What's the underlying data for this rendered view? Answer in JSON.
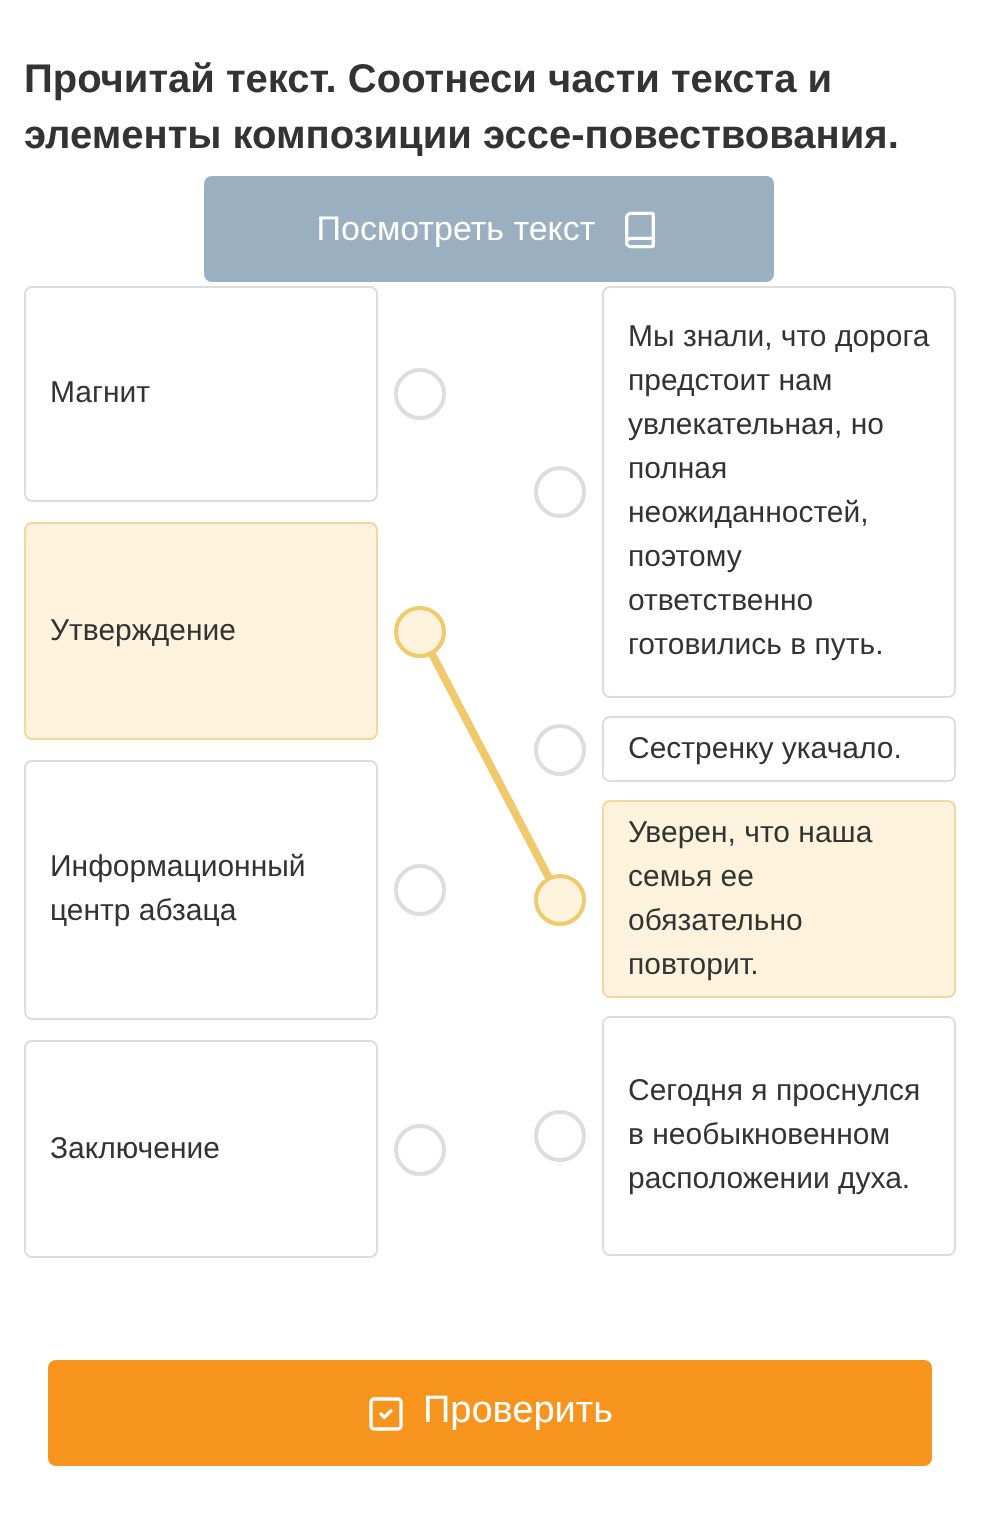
{
  "title": "Прочитай текст. Соотнеси части текста и элементы композиции эссе-повествования.",
  "view_button": {
    "label": "Посмотреть текст"
  },
  "left_items": [
    {
      "text": "Магнит",
      "selected": false,
      "connected": false
    },
    {
      "text": "Утверждение",
      "selected": true,
      "connected": true
    },
    {
      "text": "Информационный центр абзаца",
      "selected": false,
      "connected": false
    },
    {
      "text": "Заключение",
      "selected": false,
      "connected": false
    }
  ],
  "right_items": [
    {
      "text": "Мы знали, что дорога предстоит нам увлекательная, но полная неожиданностей, поэтому ответственно готовились в путь.",
      "selected": false,
      "connected": false
    },
    {
      "text": "Сестренку укачало.",
      "selected": false,
      "connected": false
    },
    {
      "text": "Уверен, что наша семья ее обязательно повторит.",
      "selected": true,
      "connected": true
    },
    {
      "text": "Сегодня я проснулся в необыкновенном расположении духа.",
      "selected": false,
      "connected": false
    }
  ],
  "check_button": {
    "label": "Проверить"
  }
}
